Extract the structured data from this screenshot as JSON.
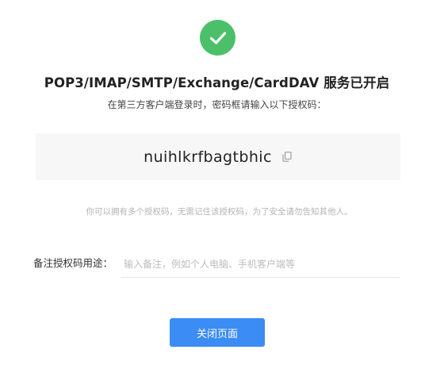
{
  "status": {
    "icon": "check-circle-icon",
    "color": "#4cbf6b"
  },
  "title": "POP3/IMAP/SMTP/Exchange/CardDAV 服务已开启",
  "subtitle": "在第三方客户端登录时，密码框请输入以下授权码：",
  "auth_code": {
    "value": "nuihlkrfbagtbhic",
    "copy_icon": "copy-icon"
  },
  "hint": "你可以拥有多个授权码，无需记住该授权码，为了安全请勿告知其他人。",
  "remark": {
    "label": "备注授权码用途：",
    "placeholder": "输入备注，例如个人电脑、手机客户端等",
    "value": ""
  },
  "close_button": {
    "label": "关闭页面",
    "color": "#3b8cf5"
  }
}
